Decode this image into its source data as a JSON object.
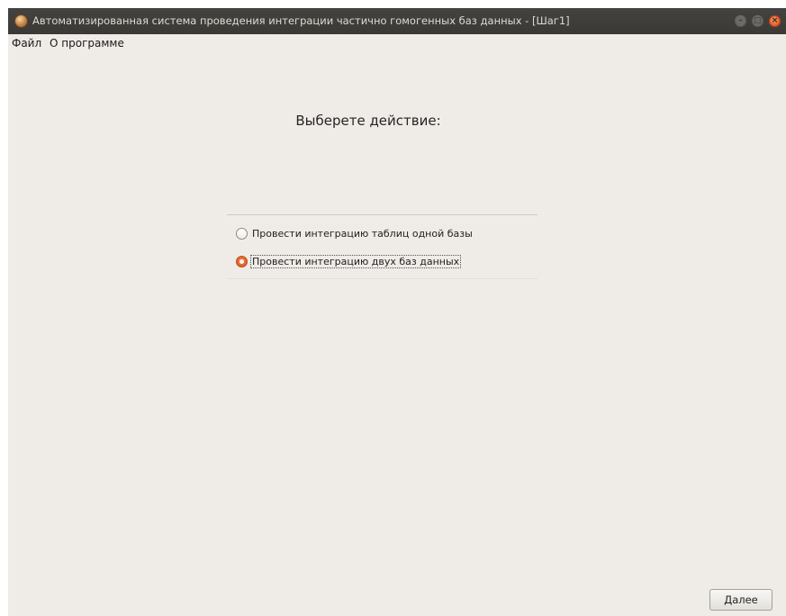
{
  "window": {
    "title": "Автоматизированная система проведения интеграции частично гомогенных баз данных - [Шаг1]",
    "icon": "app-logo-icon",
    "controls": {
      "minimize_glyph": "–",
      "maximize_glyph": "□",
      "close_glyph": "×"
    }
  },
  "menu": {
    "items": [
      {
        "label": "Файл"
      },
      {
        "label": "О программе"
      }
    ]
  },
  "main": {
    "heading": "Выберете действие:",
    "options": [
      {
        "label": "Провести интеграцию таблиц одной базы",
        "checked": false
      },
      {
        "label": "Провести интеграцию двух баз данных",
        "checked": true
      }
    ]
  },
  "footer": {
    "next_label": "Далее"
  },
  "colors": {
    "titlebar": "#3f3e3a",
    "background": "#efebe7",
    "accent": "#e0551f"
  }
}
